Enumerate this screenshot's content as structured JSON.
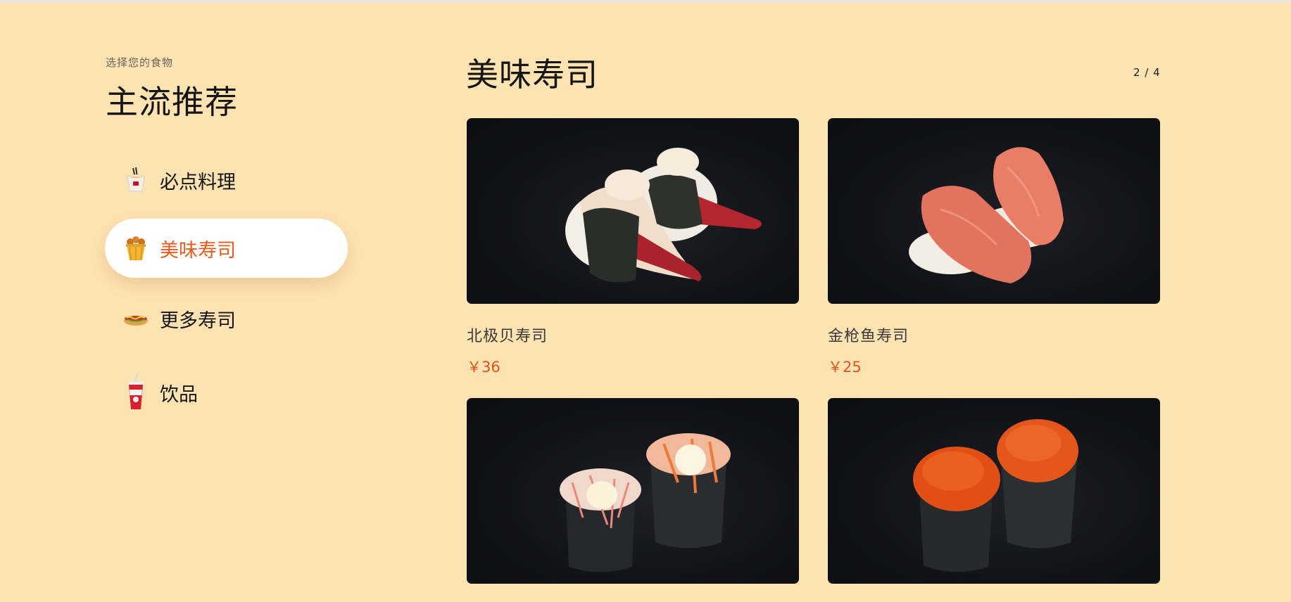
{
  "sidebar": {
    "eyebrow": "选择您的食物",
    "title": "主流推荐",
    "items": [
      {
        "label": "必点料理",
        "icon": "noodle-box-icon",
        "active": false
      },
      {
        "label": "美味寿司",
        "icon": "fried-chicken-bucket-icon",
        "active": true
      },
      {
        "label": "更多寿司",
        "icon": "hot-dog-icon",
        "active": false
      },
      {
        "label": "饮品",
        "icon": "soda-cup-icon",
        "active": false
      }
    ]
  },
  "main": {
    "title": "美味寿司",
    "pager": "2 / 4",
    "items": [
      {
        "name": "北极贝寿司",
        "price": "￥36"
      },
      {
        "name": "金枪鱼寿司",
        "price": "￥25"
      },
      {
        "name": "",
        "price": ""
      },
      {
        "name": "",
        "price": ""
      }
    ]
  },
  "colors": {
    "background": "#fde2b2",
    "accent": "#ea5a1c",
    "card_background": "#111217"
  }
}
